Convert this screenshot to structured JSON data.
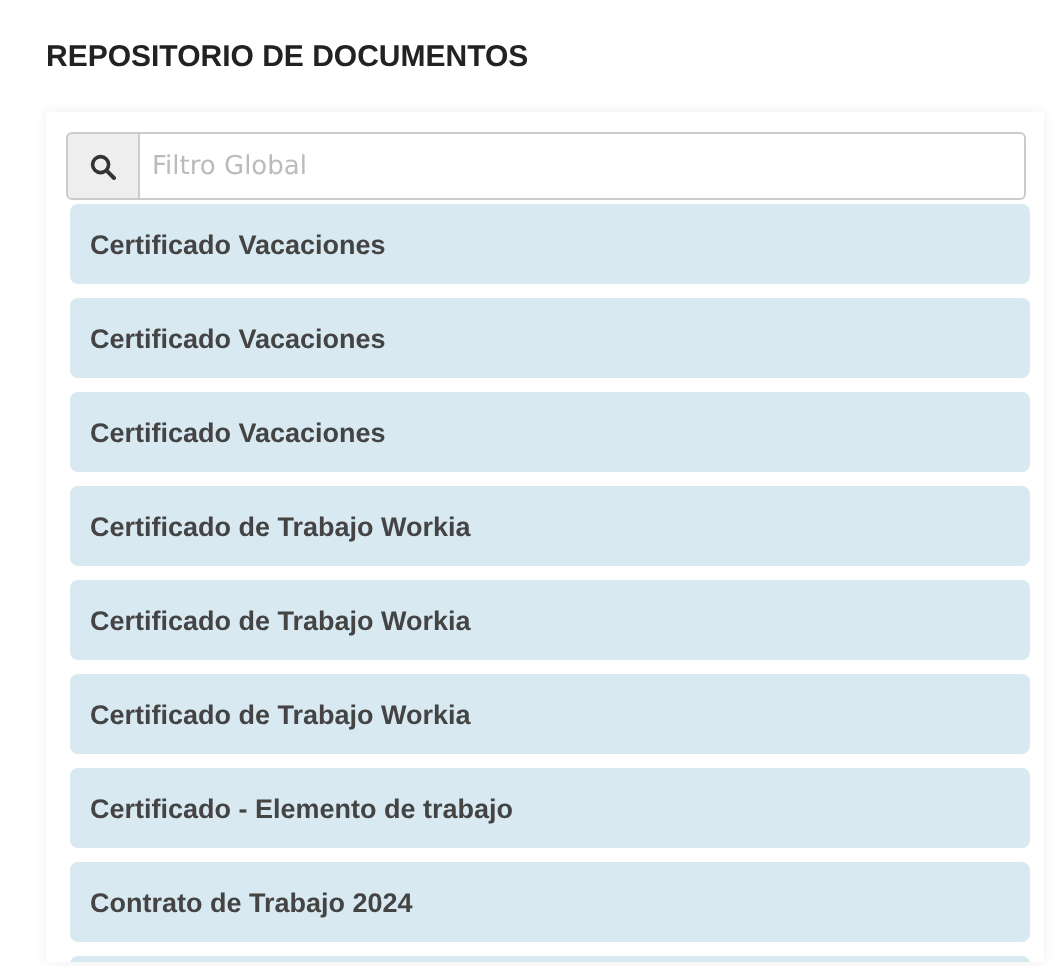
{
  "title": "REPOSITORIO DE DOCUMENTOS",
  "search": {
    "placeholder": "Filtro Global"
  },
  "documents": [
    {
      "label": "Certificado Vacaciones"
    },
    {
      "label": "Certificado Vacaciones"
    },
    {
      "label": "Certificado Vacaciones"
    },
    {
      "label": "Certificado de Trabajo Workia"
    },
    {
      "label": "Certificado de Trabajo Workia"
    },
    {
      "label": "Certificado de Trabajo Workia"
    },
    {
      "label": "Certificado - Elemento de trabajo"
    },
    {
      "label": "Contrato de Trabajo 2024"
    }
  ],
  "more_below": true
}
